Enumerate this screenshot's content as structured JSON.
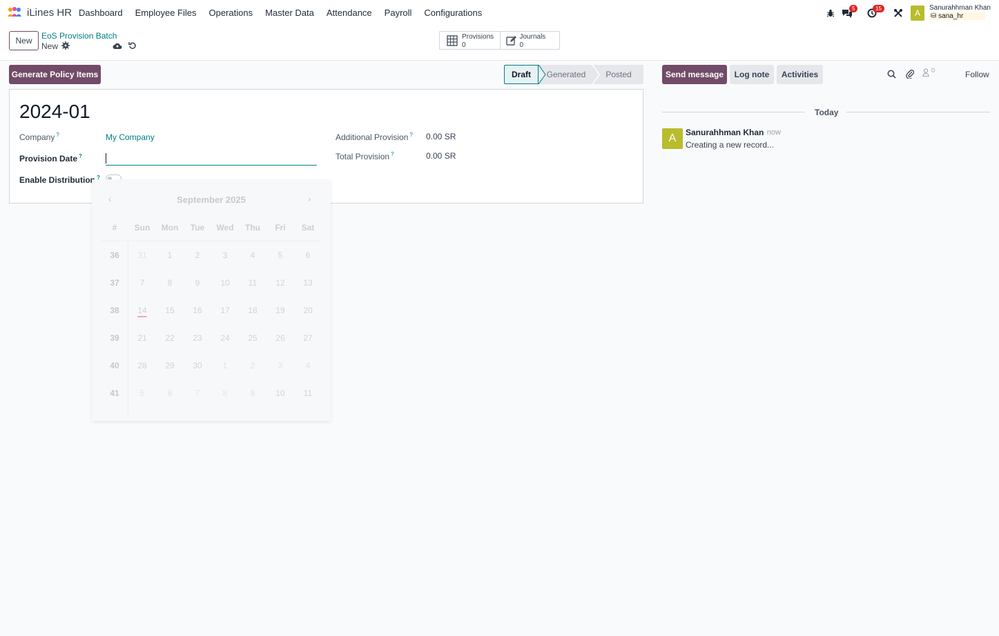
{
  "navbar": {
    "app_name": "iLines HR",
    "menu": [
      "Dashboard",
      "Employee Files",
      "Operations",
      "Master Data",
      "Attendance",
      "Payroll",
      "Configurations"
    ],
    "chat_badge": "5",
    "activity_badge": "15",
    "user_initial": "A",
    "user_name": "Sanurahhman Khan",
    "user_db": "sana_hr"
  },
  "control_panel": {
    "new_label": "New",
    "breadcrumb_parent": "EoS Provision Batch",
    "breadcrumb_current": "New",
    "stat_buttons": [
      {
        "label": "Provisions",
        "value": "0"
      },
      {
        "label": "Journals",
        "value": "0"
      }
    ]
  },
  "actions": {
    "generate_label": "Generate Policy Items",
    "stages": [
      "Draft",
      "Generated",
      "Posted"
    ],
    "active_stage": "Draft"
  },
  "form": {
    "record_name": "2024-01",
    "fields_left": [
      {
        "label": "Company",
        "value": "My Company"
      },
      {
        "label": "Provision Date",
        "value": ""
      },
      {
        "label": "Enable Distribution",
        "value": ""
      }
    ],
    "fields_right": [
      {
        "label": "Additional Provision",
        "value": "0.00 SR"
      },
      {
        "label": "Total Provision",
        "value": "0.00 SR"
      }
    ]
  },
  "datepicker": {
    "month_label": "September 2025",
    "headers": [
      "#",
      "Sun",
      "Mon",
      "Tue",
      "Wed",
      "Thu",
      "Fri",
      "Sat"
    ],
    "today": "14",
    "weeks": [
      {
        "week": "36",
        "days": [
          "31",
          "1",
          "2",
          "3",
          "4",
          "5",
          "6"
        ]
      },
      {
        "week": "37",
        "days": [
          "7",
          "8",
          "9",
          "10",
          "11",
          "12",
          "13"
        ]
      },
      {
        "week": "38",
        "days": [
          "14",
          "15",
          "16",
          "17",
          "18",
          "19",
          "20"
        ]
      },
      {
        "week": "39",
        "days": [
          "21",
          "22",
          "23",
          "24",
          "25",
          "26",
          "27"
        ]
      },
      {
        "week": "40",
        "days": [
          "28",
          "29",
          "30",
          "1",
          "2",
          "3",
          "4"
        ]
      },
      {
        "week": "41",
        "days": [
          "5",
          "6",
          "7",
          "8",
          "9",
          "10",
          "11"
        ]
      }
    ]
  },
  "chatter": {
    "send_message": "Send message",
    "log_note": "Log note",
    "activities": "Activities",
    "followers_count": "0",
    "follow": "Follow",
    "today": "Today",
    "message": {
      "author_initial": "A",
      "author": "Sanurahhman Khan",
      "time": "- now",
      "body": "Creating a new record..."
    }
  },
  "colors": {
    "brand": "#714b67",
    "link": "#017e84",
    "avatar": "#b8bc2d",
    "badge": "#dc2626"
  }
}
